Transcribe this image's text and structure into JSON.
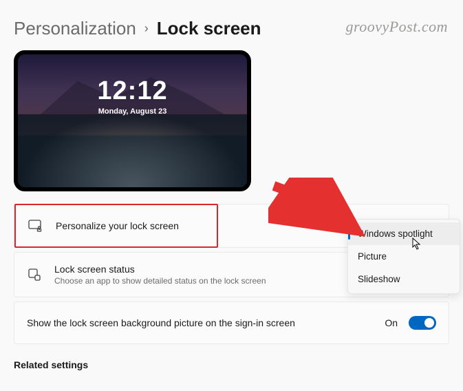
{
  "watermark": "groovyPost.com",
  "breadcrumb": {
    "parent": "Personalization",
    "current": "Lock screen"
  },
  "preview": {
    "time": "12:12",
    "date": "Monday, August 23"
  },
  "rows": {
    "personalize": {
      "title": "Personalize your lock screen"
    },
    "status": {
      "title": "Lock screen status",
      "subtitle": "Choose an app to show detailed status on the lock screen"
    },
    "signin": {
      "title": "Show the lock screen background picture on the sign-in screen",
      "value": "On"
    }
  },
  "dropdown": {
    "options": [
      "Windows spotlight",
      "Picture",
      "Slideshow"
    ],
    "selected": "Windows spotlight"
  },
  "related": "Related settings"
}
